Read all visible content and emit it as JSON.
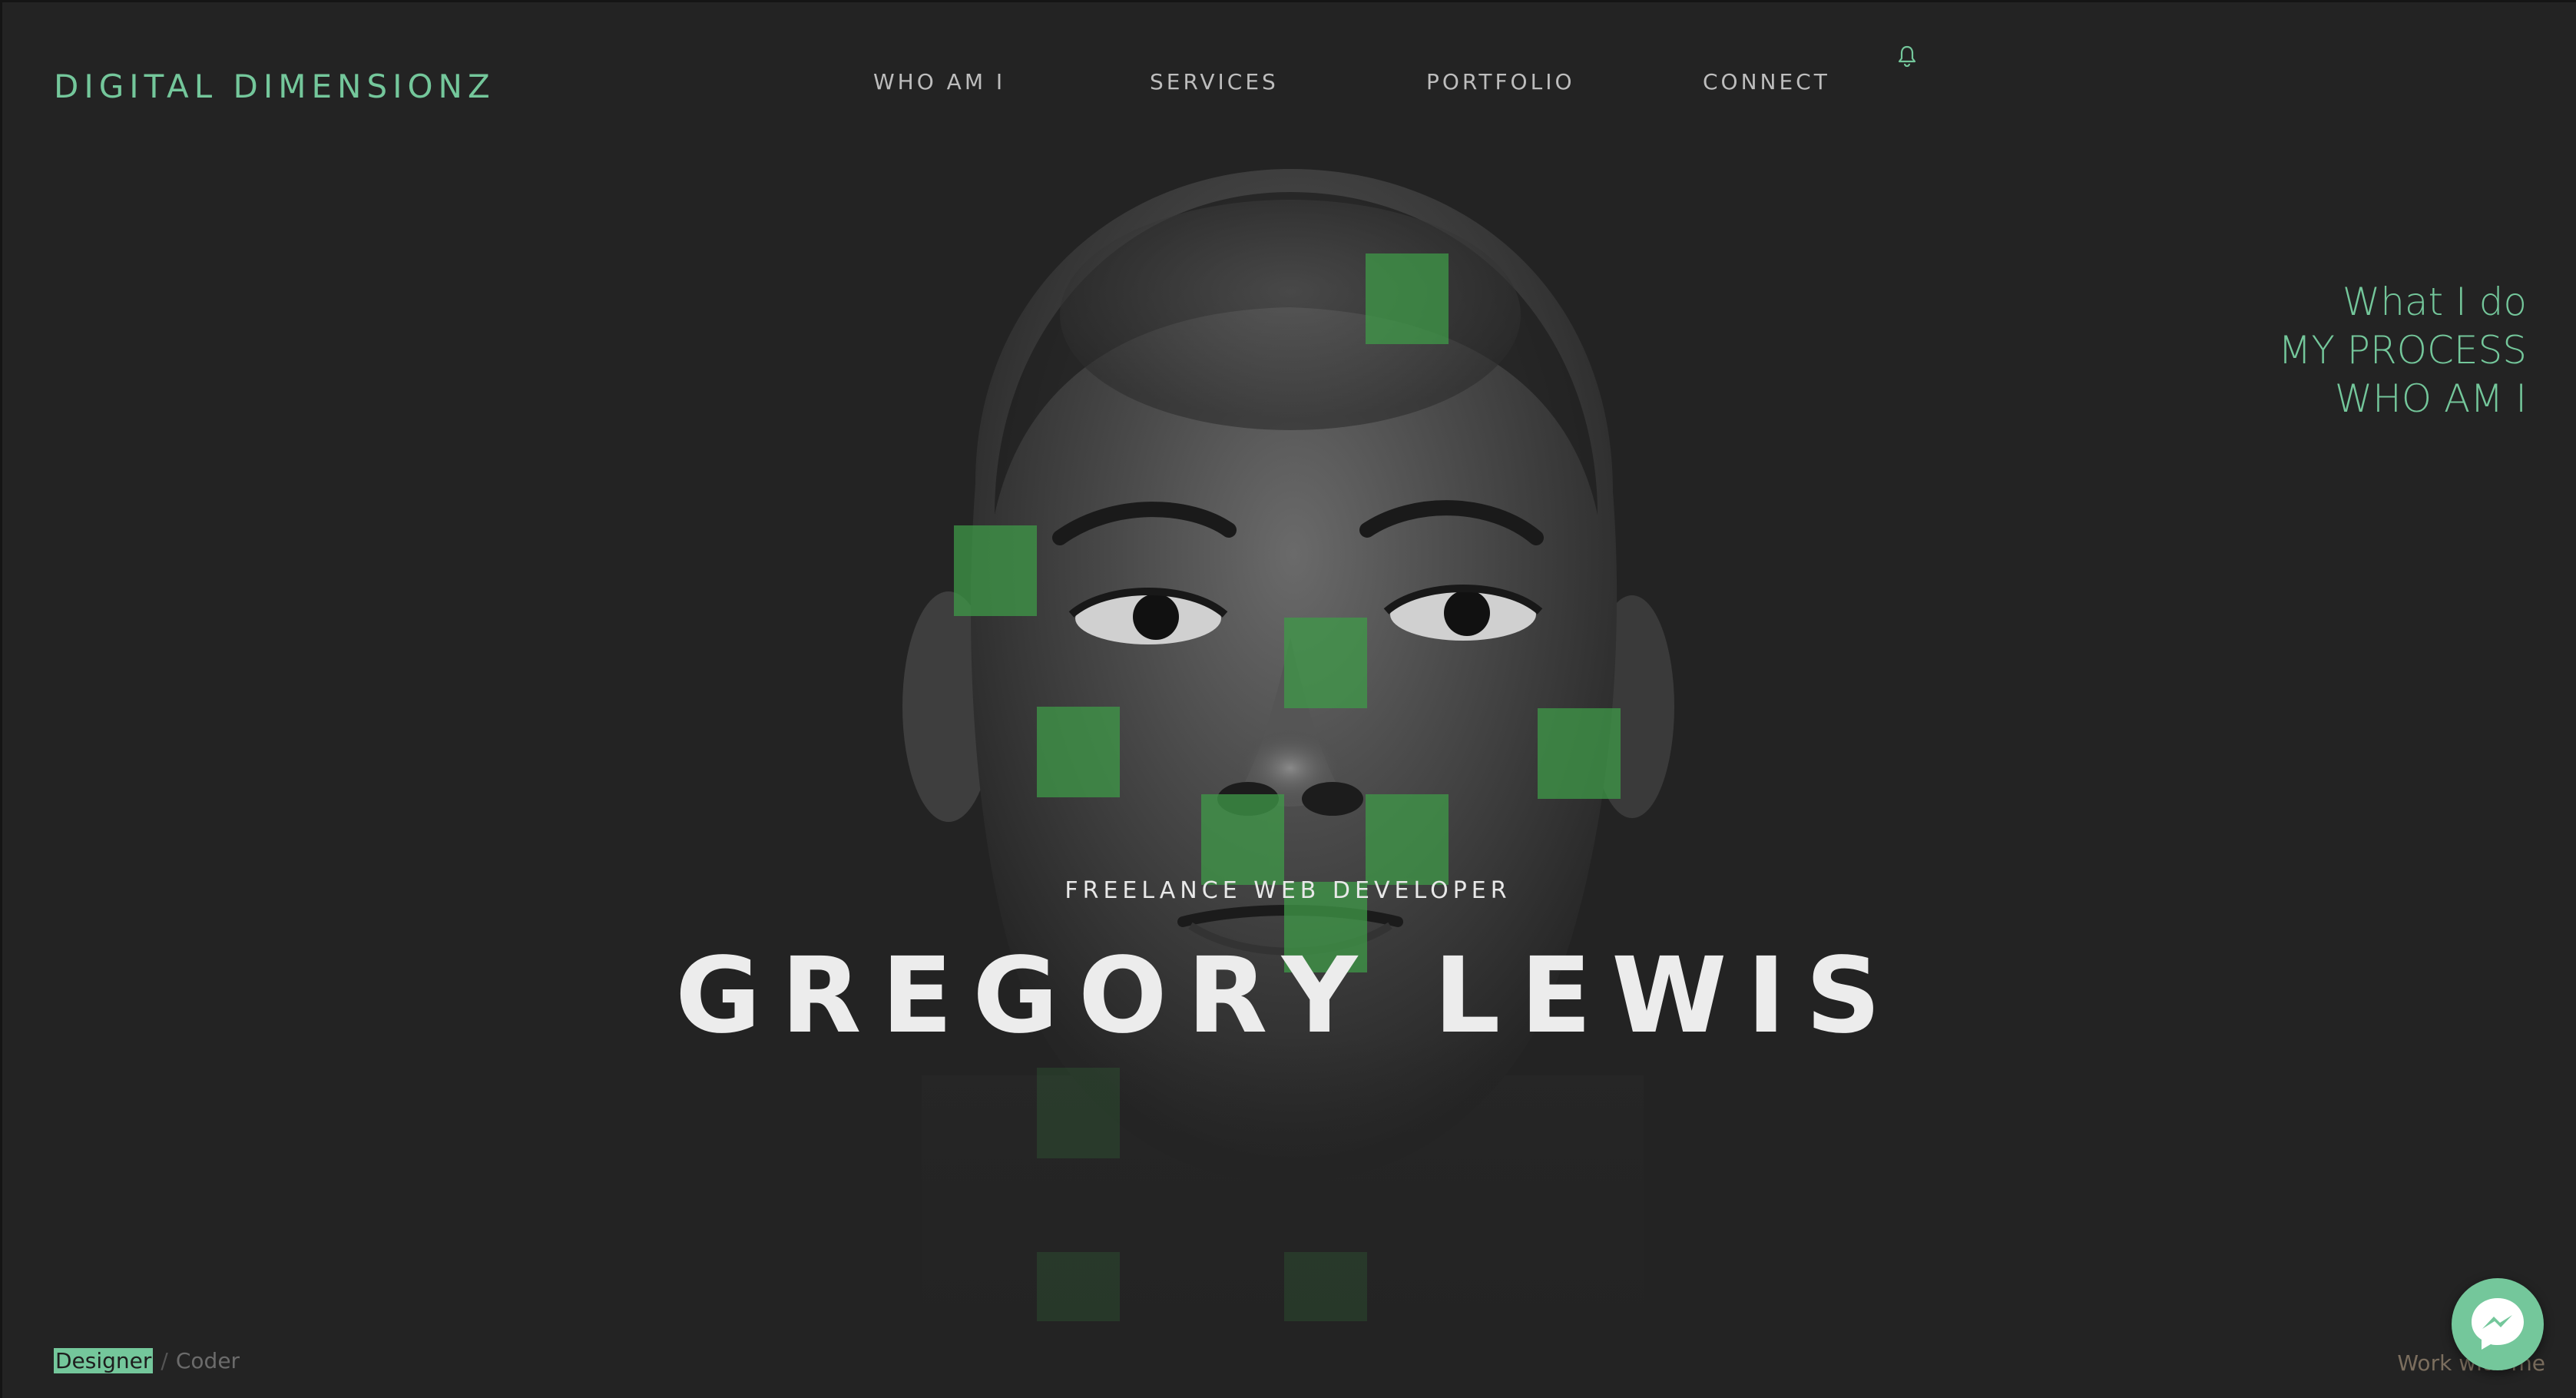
{
  "header": {
    "logo": "DIGITAL DIMENSIONZ",
    "nav": [
      {
        "label": "WHO AM I"
      },
      {
        "label": "SERVICES"
      },
      {
        "label": "PORTFOLIO"
      },
      {
        "label": "CONNECT"
      }
    ],
    "notification_icon": "bell-icon"
  },
  "side_menu": {
    "items": [
      {
        "label": "What I do"
      },
      {
        "label": "MY PROCESS"
      },
      {
        "label": "WHO AM I"
      }
    ]
  },
  "hero": {
    "subtitle": "FREELANCE WEB DEVELOPER",
    "title": "GREGORY LEWIS"
  },
  "footer": {
    "roles": {
      "active": "Designer",
      "separator": "/",
      "inactive": "Coder"
    },
    "work_link": "Work with me",
    "chat_icon": "messenger-icon"
  },
  "colors": {
    "accent": "#74c79b",
    "background": "#232323",
    "text_light": "#ececec",
    "nav_text": "#bdbdbd"
  }
}
